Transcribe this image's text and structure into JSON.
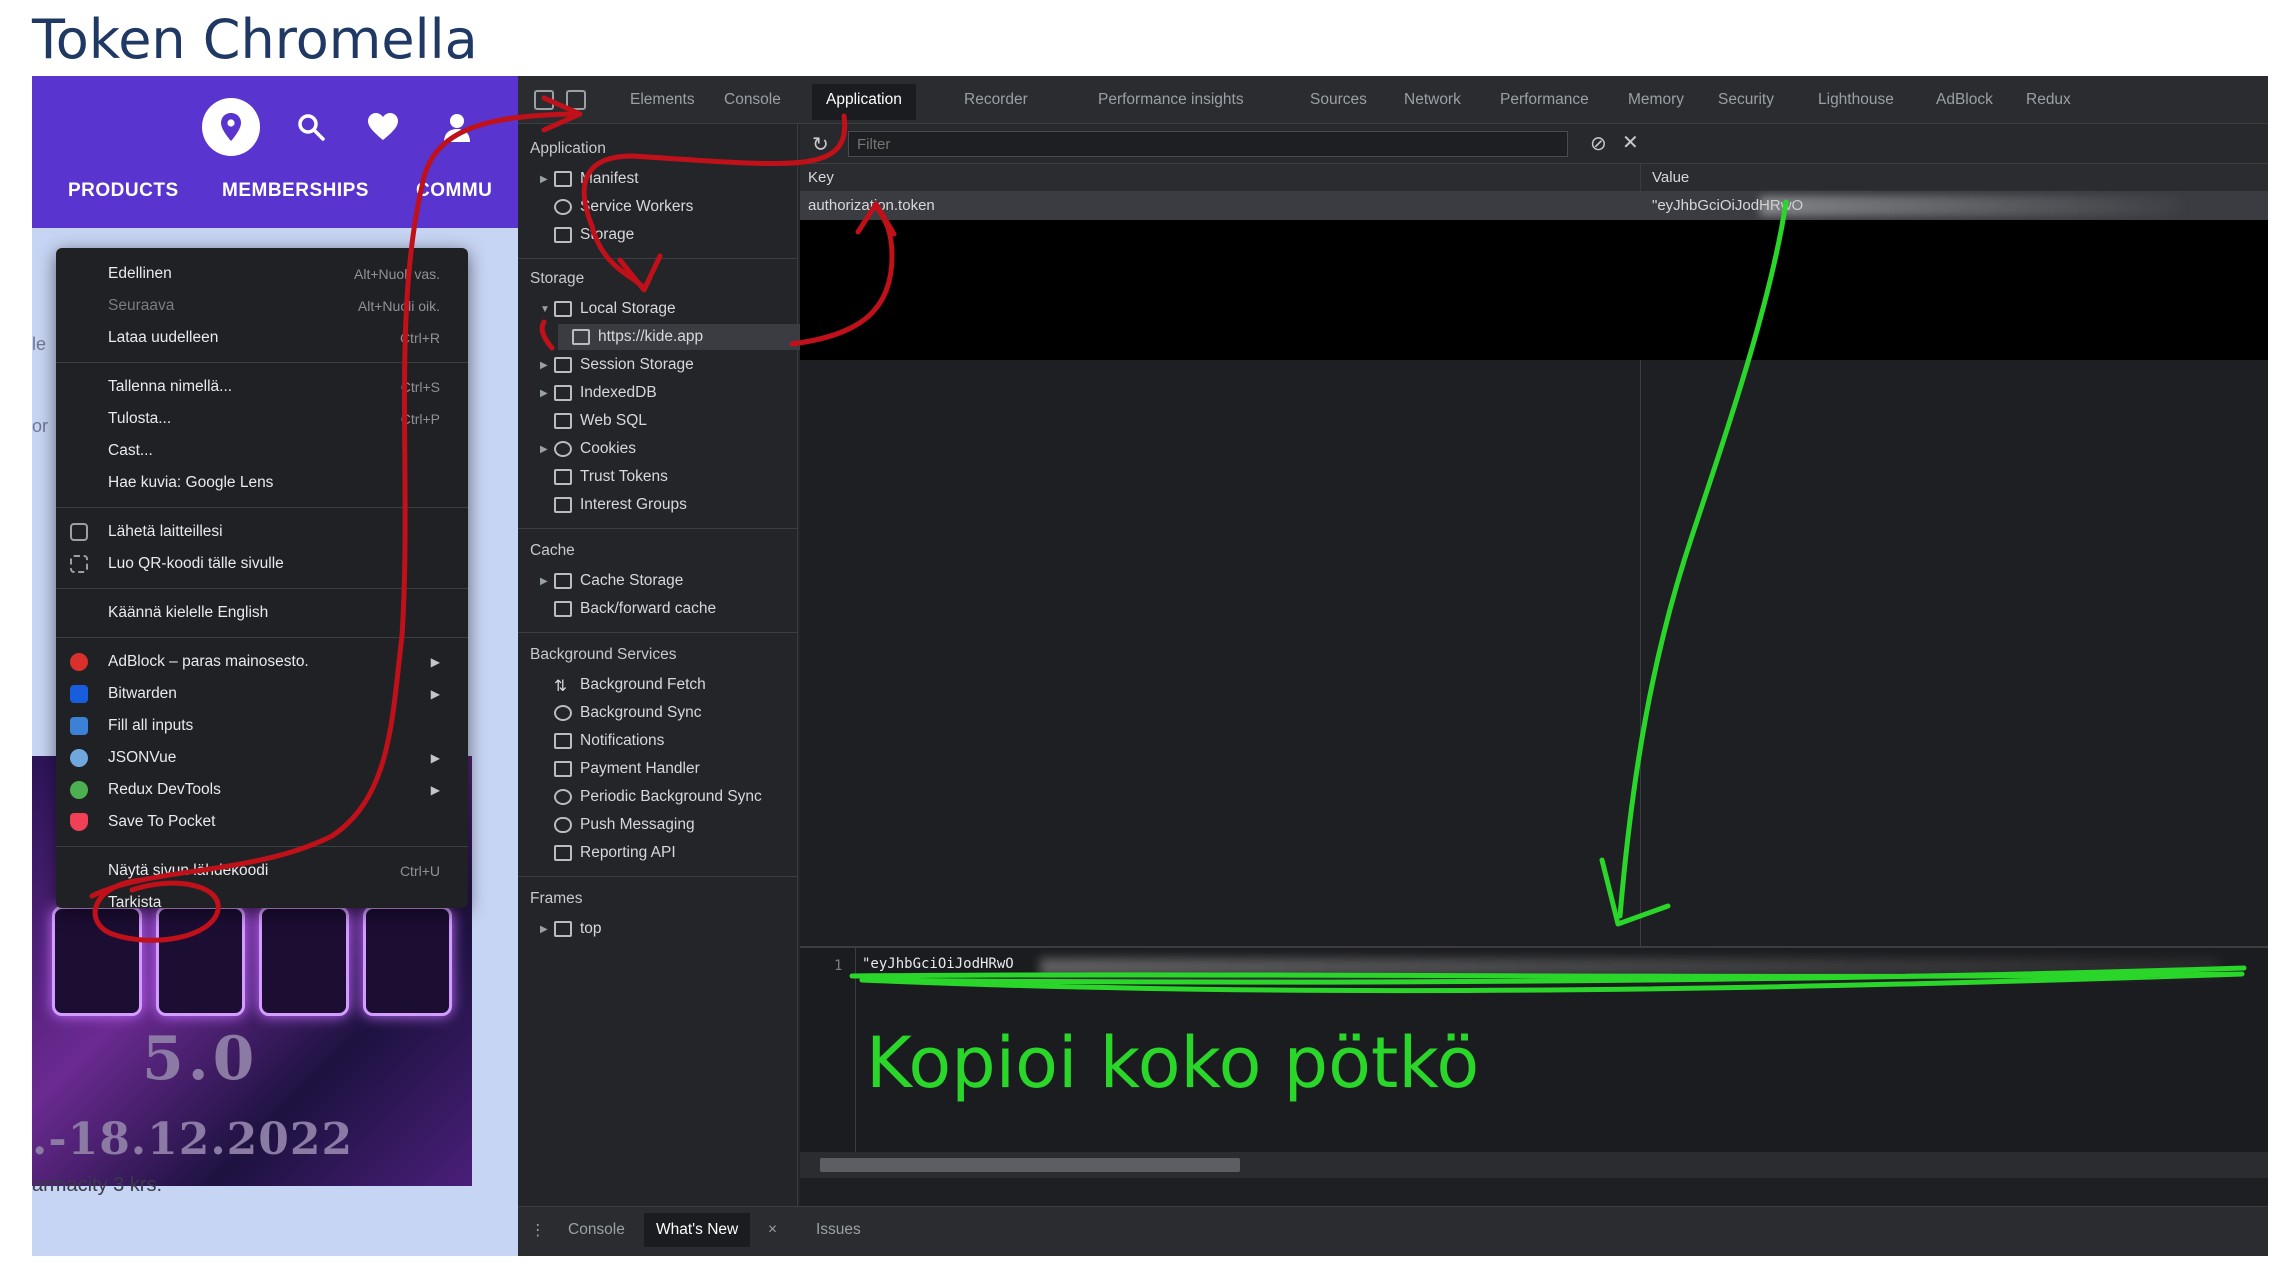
{
  "title": "Token Chromella",
  "webpage": {
    "nav": [
      "PRODUCTS",
      "MEMBERSHIPS",
      "COMMU"
    ],
    "banner_version": "5.0",
    "banner_date": ".-18.12.2022",
    "venue": "armacity 3 krs.",
    "edge_text_a": "le",
    "edge_text_b": "or"
  },
  "context_menu": {
    "items": [
      {
        "label": "Edellinen",
        "shortcut": "Alt+Nuoli vas."
      },
      {
        "label": "Seuraava",
        "shortcut": "Alt+Nuoli oik."
      },
      {
        "label": "Lataa uudelleen",
        "shortcut": "Ctrl+R"
      },
      {
        "label": "Tallenna nimellä...",
        "shortcut": "Ctrl+S"
      },
      {
        "label": "Tulosta...",
        "shortcut": "Ctrl+P"
      },
      {
        "label": "Cast..."
      },
      {
        "label": "Hae kuvia: Google Lens"
      },
      {
        "label": "Lähetä laitteillesi"
      },
      {
        "label": "Luo QR-koodi tälle sivulle"
      },
      {
        "label": "Käännä kielelle English"
      },
      {
        "label": "AdBlock – paras mainosesto."
      },
      {
        "label": "Bitwarden"
      },
      {
        "label": "Fill all inputs"
      },
      {
        "label": "JSONVue"
      },
      {
        "label": "Redux DevTools"
      },
      {
        "label": "Save To Pocket"
      },
      {
        "label": "Näytä sivun lähdekoodi",
        "shortcut": "Ctrl+U"
      },
      {
        "label": "Tarkista"
      }
    ]
  },
  "devtools": {
    "tabs": [
      "Elements",
      "Console",
      "Application",
      "Recorder",
      "Performance insights",
      "Sources",
      "Network",
      "Performance",
      "Memory",
      "Security",
      "Lighthouse",
      "AdBlock",
      "Redux"
    ],
    "sidebar": {
      "application_title": "Application",
      "application_items": [
        "Manifest",
        "Service Workers",
        "Storage"
      ],
      "storage_title": "Storage",
      "storage_items": [
        "Local Storage",
        "https://kide.app",
        "Session Storage",
        "IndexedDB",
        "Web SQL",
        "Cookies",
        "Trust Tokens",
        "Interest Groups"
      ],
      "cache_title": "Cache",
      "cache_items": [
        "Cache Storage",
        "Back/forward cache"
      ],
      "bg_title": "Background Services",
      "bg_items": [
        "Background Fetch",
        "Background Sync",
        "Notifications",
        "Payment Handler",
        "Periodic Background Sync",
        "Push Messaging",
        "Reporting API"
      ],
      "frames_title": "Frames",
      "frames_items": [
        "top"
      ]
    },
    "filter_placeholder": "Filter",
    "table": {
      "col_key": "Key",
      "col_value": "Value",
      "row_key": "authorization.token",
      "row_value": "\"eyJhbGciOiJodHRwO"
    },
    "preview": {
      "line": "1",
      "code": "\"eyJhbGciOiJodHRwO"
    },
    "drawer_tabs": [
      "Console",
      "What's New",
      "Issues"
    ]
  },
  "annotation_text": "Kopioi koko pötkö",
  "colors": {
    "red_annotation": "#c0101a",
    "green_annotation": "#29d629",
    "brand_purple": "#5a34cf"
  }
}
